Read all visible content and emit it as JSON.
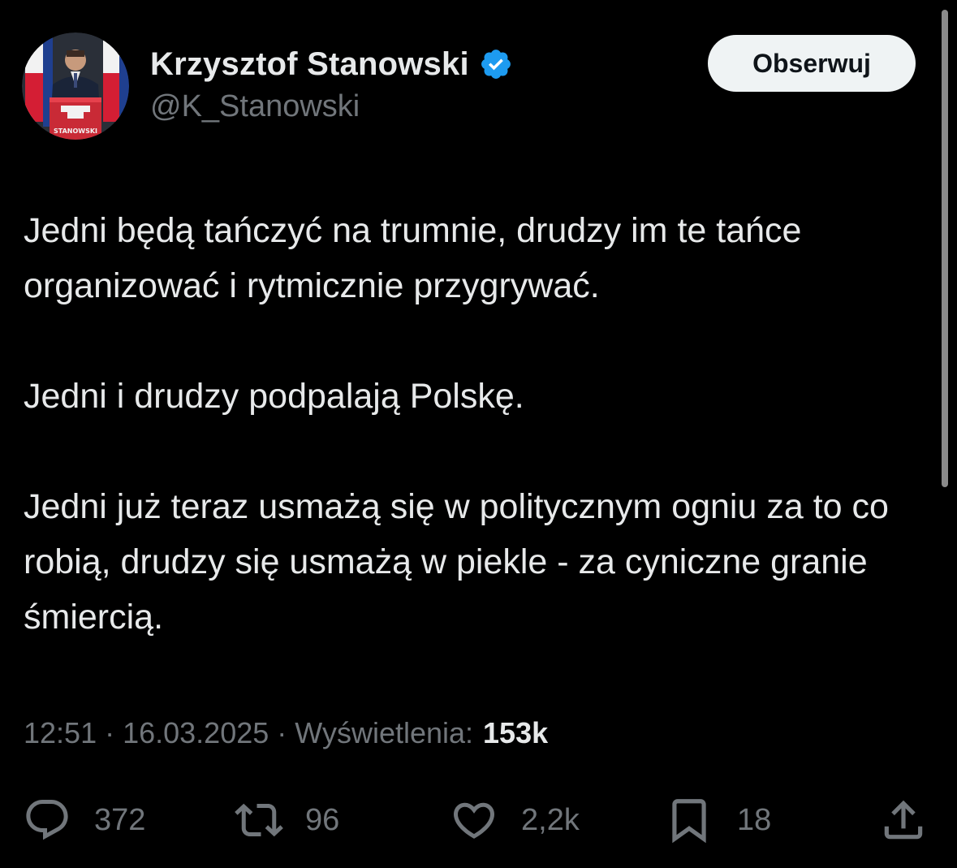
{
  "author": {
    "name": "Krzysztof Stanowski",
    "handle": "@K_Stanowski",
    "verified": true,
    "avatar_podium_text": "STANOWSKI"
  },
  "follow_button": {
    "label": "Obserwuj"
  },
  "tweet": {
    "paragraphs": [
      "Jedni będą tańczyć na trumnie, drudzy im te tańce organizować i rytmicznie przygrywać.",
      "Jedni i drudzy podpalają Polskę.",
      "Jedni już teraz usmażą się w politycznym ogniu za to co robią, drudzy się usmażą w piekle - za cyniczne granie śmiercią."
    ]
  },
  "meta": {
    "time": "12:51",
    "date": "16.03.2025",
    "views_label": "Wyświetlenia:",
    "views_count": "153k",
    "separator": "·"
  },
  "actions": {
    "replies": "372",
    "reposts": "96",
    "likes": "2,2k",
    "bookmarks": "18"
  },
  "icons": {
    "reply": "reply-icon",
    "repost": "repost-icon",
    "like": "heart-icon",
    "bookmark": "bookmark-icon",
    "share": "share-icon",
    "verified": "verified-badge-icon"
  },
  "colors": {
    "background": "#000000",
    "text": "#e7e9ea",
    "secondary": "#71767b",
    "verified": "#1d9bf0",
    "button_bg": "#eff3f4"
  }
}
